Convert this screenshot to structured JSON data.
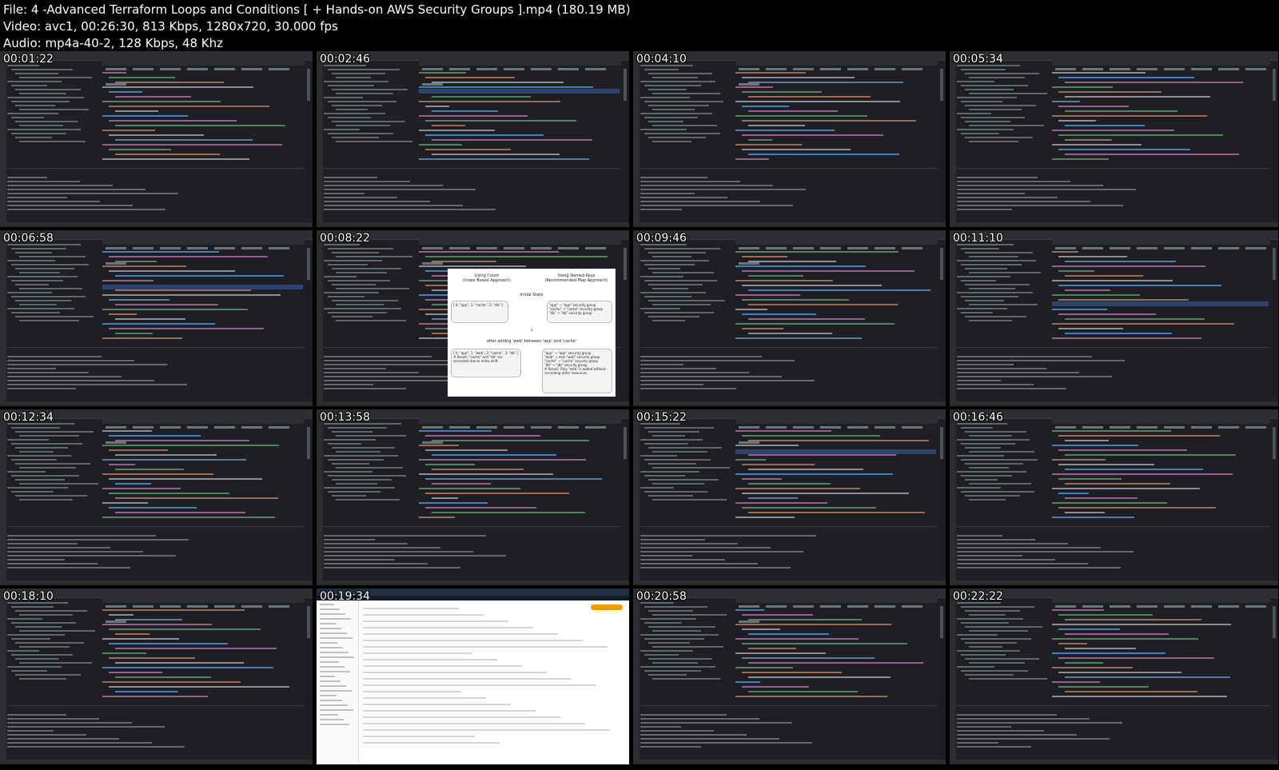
{
  "header": {
    "file_line": "File: 4 -Advanced Terraform Loops and Conditions [ + Hands-on AWS Security Groups ].mp4 (180.19 MB)",
    "video_line": "Video: avc1, 00:26:30, 813 Kbps, 1280x720, 30.000 fps",
    "audio_line": "Audio: mp4a-40-2, 128 Kbps, 48 Khz"
  },
  "thumbnails": [
    {
      "time": "00:01:22",
      "kind": "ide"
    },
    {
      "time": "00:02:46",
      "kind": "ide"
    },
    {
      "time": "00:04:10",
      "kind": "ide"
    },
    {
      "time": "00:05:34",
      "kind": "ide"
    },
    {
      "time": "00:06:58",
      "kind": "ide"
    },
    {
      "time": "00:08:22",
      "kind": "diagram"
    },
    {
      "time": "00:09:46",
      "kind": "ide"
    },
    {
      "time": "00:11:10",
      "kind": "ide"
    },
    {
      "time": "00:12:34",
      "kind": "ide"
    },
    {
      "time": "00:13:58",
      "kind": "ide"
    },
    {
      "time": "00:15:22",
      "kind": "ide"
    },
    {
      "time": "00:16:46",
      "kind": "ide"
    },
    {
      "time": "00:18:10",
      "kind": "ide"
    },
    {
      "time": "00:19:34",
      "kind": "aws"
    },
    {
      "time": "00:20:58",
      "kind": "ide"
    },
    {
      "time": "00:22:22",
      "kind": "ide"
    }
  ],
  "diagram": {
    "left_title": "Using Count\n(Index Based Approach)",
    "right_title": "Using Named Keys\n(Recommended Map Approach)",
    "initial_state": "Initial State",
    "left_initial": "[ 0: \"app\", 1: \"cache\", 2: \"db\" ]",
    "right_initial": "\"app\"  → \"app\" security group\n\"cache\" → \"cache\" security group\n\"db\"  → \"db\" security group",
    "after_text": "after adding 'web' between 'app' and 'cache'",
    "left_after": "[ 0: \"app\", 1: \"web\", 2: \"cache\", 3: \"db\" ]",
    "left_note": "# Result: \"cache\" and \"db\" are recreated due to index shift.",
    "right_after": "\"app\"  → \"app\" security group\n\"web\"  → new \"web\" security group\n\"cache\" → \"cache\" security group\n\"db\"  → \"db\" security group",
    "right_note": "# Result: Only \"web\" is added without recreating other resources."
  },
  "colors": {
    "background": "#000000",
    "ide_bg": "#1e1f22",
    "code_purple": "#c77dbb",
    "code_green": "#6aab73",
    "code_orange": "#cf8e6d",
    "aws_orange": "#ff9900"
  }
}
